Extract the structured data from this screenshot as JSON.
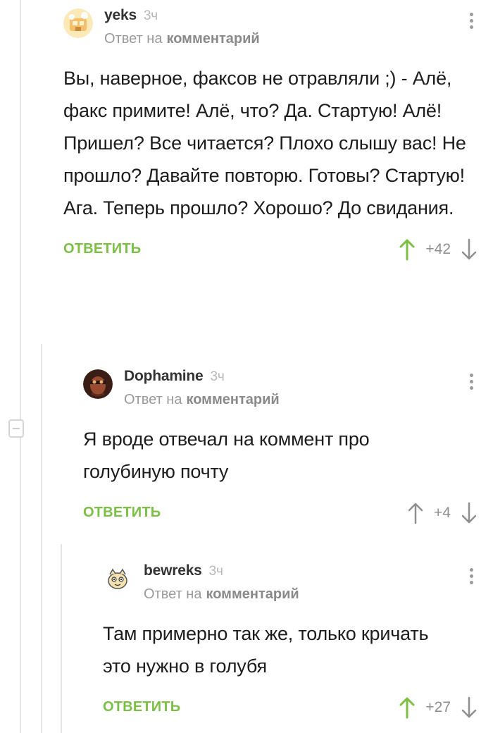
{
  "comments": [
    {
      "author": "yeks",
      "time": "3ч",
      "reply_prefix": "Ответ на",
      "reply_link": "комментарий",
      "text": "Вы, наверное, факсов не отравляли ;) - Алё, факс примите! Алё, что? Да. Стартую! Алё! Пришел? Все читается? Плохо слышу вас! Не прошло? Давайте повторю. Готовы? Стартую! Ага. Теперь прошло? Хорошо? До свидания.",
      "reply_label": "ОТВЕТИТЬ",
      "score": "+42",
      "upvoted": true
    },
    {
      "author": "Dophamine",
      "time": "3ч",
      "reply_prefix": "Ответ на",
      "reply_link": "комментарий",
      "text": "Я вроде отвечал на коммент про голубиную почту",
      "reply_label": "ОТВЕТИТЬ",
      "score": "+4",
      "upvoted": false
    },
    {
      "author": "bewreks",
      "time": "3ч",
      "reply_prefix": "Ответ на",
      "reply_link": "комментарий",
      "text": "Там примерно так же, только кричать это нужно в голубя",
      "reply_label": "ОТВЕТИТЬ",
      "score": "+27",
      "upvoted": true
    }
  ],
  "colors": {
    "accent_green": "#7ac142",
    "muted_gray": "#8f8f8f",
    "thread_line": "#e6e6e6"
  },
  "icons": [
    "collapse-icon",
    "kebab-menu-icon",
    "arrow-up-icon",
    "arrow-down-icon",
    "avatar"
  ]
}
